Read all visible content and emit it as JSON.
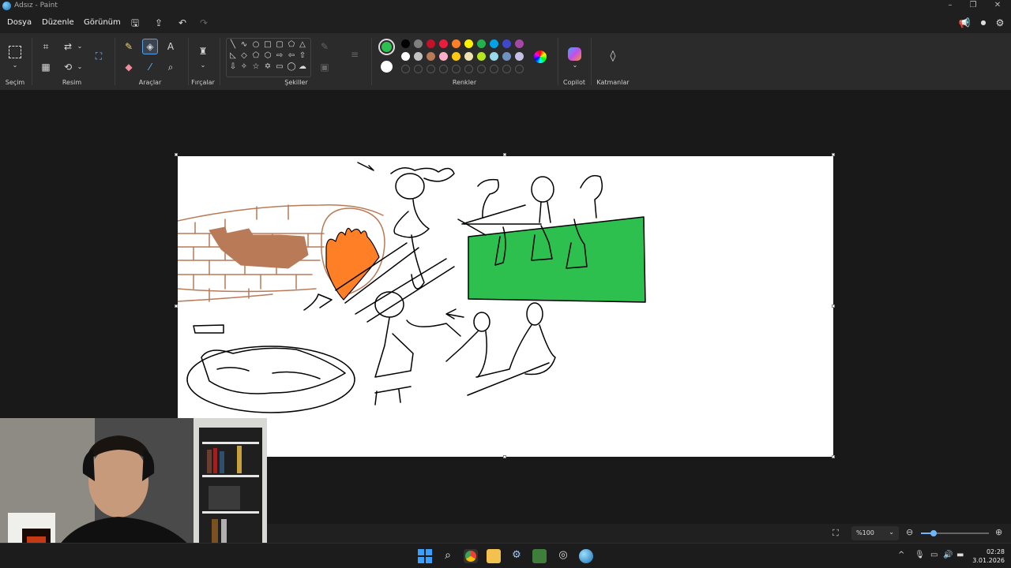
{
  "window": {
    "title": "Adsız - Paint"
  },
  "menu": {
    "file": "Dosya",
    "edit": "Düzenle",
    "view": "Görünüm"
  },
  "ribbon": {
    "groups": {
      "selection": "Seçim",
      "image": "Resim",
      "tools": "Araçlar",
      "brushes": "Fırçalar",
      "shapes": "Şekiller",
      "colors": "Renkler",
      "copilot": "Copilot",
      "layers": "Katmanlar"
    },
    "primary_color": "#2ec04f",
    "secondary_color": "#ffffff",
    "palette_row1": [
      "#000000",
      "#7f7f7f",
      "#c4112a",
      "#ec1c3e",
      "#ff7f27",
      "#fff200",
      "#22b14c",
      "#00a2e8",
      "#3f48cc",
      "#a349a4"
    ],
    "palette_row2": [
      "#ffffff",
      "#c3c3c3",
      "#b97a57",
      "#ffaec9",
      "#ffc90e",
      "#efe4b0",
      "#b5e61d",
      "#99d9ea",
      "#7092be",
      "#c8bfe7"
    ]
  },
  "status": {
    "zoom": "%100"
  },
  "taskbar": {
    "time": "02:28",
    "date": "3.01.2026"
  }
}
